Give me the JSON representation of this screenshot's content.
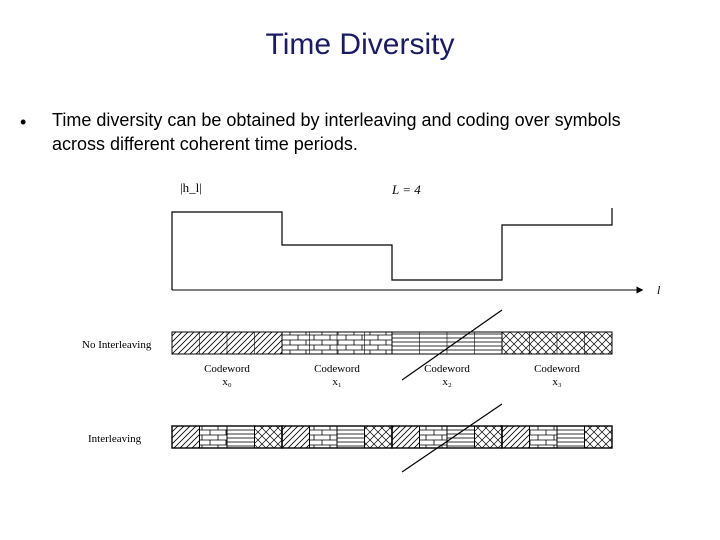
{
  "title": "Time Diversity",
  "bullet": "Time diversity can be obtained by interleaving and coding over symbols across different coherent time periods.",
  "figure": {
    "yLabel": "|h_l|",
    "param": "L = 4",
    "xLabel": "l",
    "rowLabels": [
      "No Interleaving",
      "Interleaving"
    ],
    "codewords": [
      "Codeword",
      "Codeword",
      "Codeword",
      "Codeword"
    ],
    "codewordSubs": [
      "x₀",
      "x₁",
      "x₂",
      "x₃"
    ]
  }
}
